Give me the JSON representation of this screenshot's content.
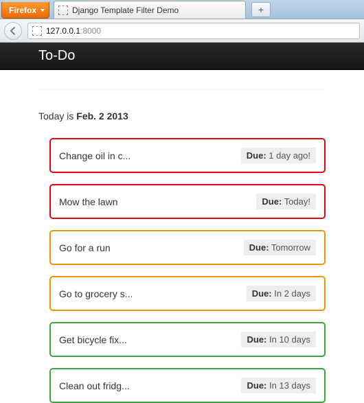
{
  "browser": {
    "firefox_label": "Firefox",
    "tab_title": "Django Template Filter Demo",
    "new_tab_glyph": "+",
    "url_host": "127.0.0.1",
    "url_port": ":8000"
  },
  "page": {
    "brand": "To-Do",
    "today_prefix": "Today is ",
    "today_date": "Feb. 2 2013",
    "due_label": "Due:"
  },
  "tasks": [
    {
      "title": "Change oil in c...",
      "due": "1 day ago!",
      "color": "red"
    },
    {
      "title": "Mow the lawn",
      "due": "Today!",
      "color": "red"
    },
    {
      "title": "Go for a run",
      "due": "Tomorrow",
      "color": "orange"
    },
    {
      "title": "Go to grocery s...",
      "due": "In 2 days",
      "color": "orange"
    },
    {
      "title": "Get bicycle fix...",
      "due": "In 10 days",
      "color": "green"
    },
    {
      "title": "Clean out fridg...",
      "due": "In 13 days",
      "color": "green"
    }
  ],
  "colors": {
    "red": "#e30613",
    "orange": "#f39200",
    "green": "#3aa935"
  }
}
